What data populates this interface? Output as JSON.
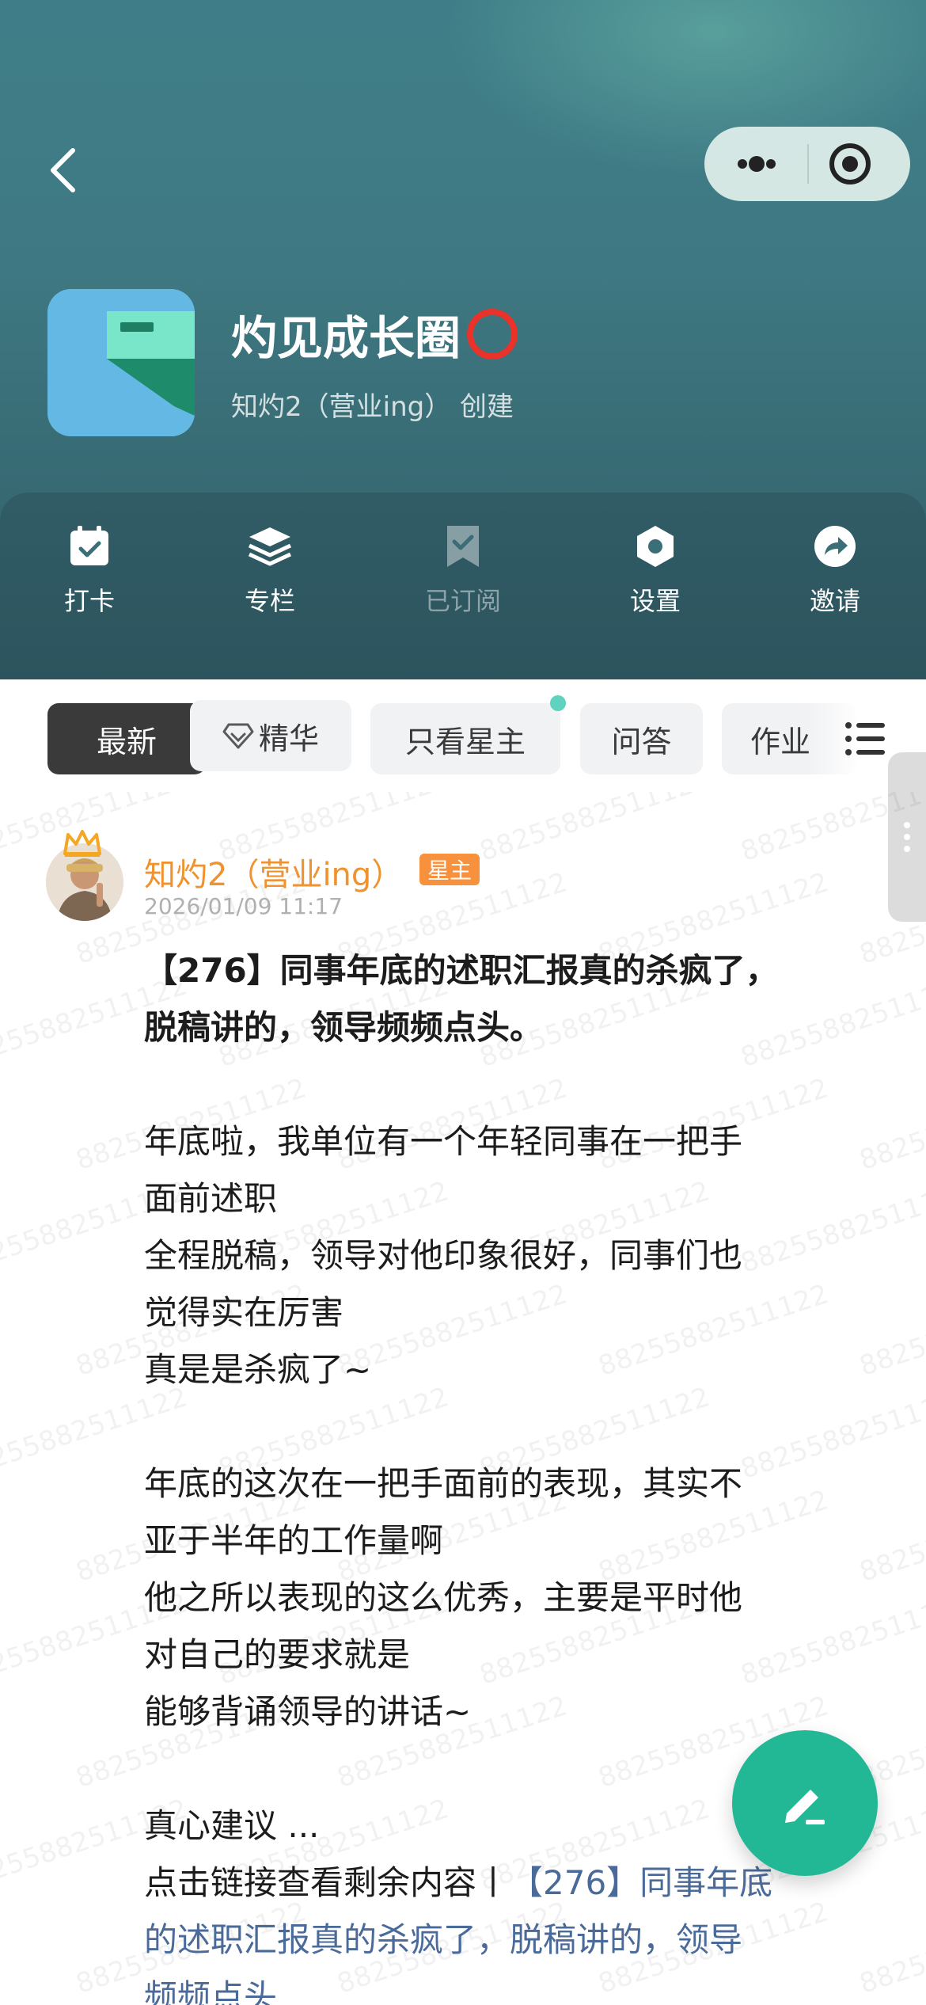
{
  "header": {
    "circle_name": "灼见成长圈",
    "creator_line": "知灼2（营业ing） 创建",
    "actions": [
      {
        "label": "打卡",
        "icon": "checkin-calendar-icon"
      },
      {
        "label": "专栏",
        "icon": "layers-icon"
      },
      {
        "label": "已订阅",
        "icon": "bookmark-check-icon"
      },
      {
        "label": "设置",
        "icon": "hexagon-settings-icon"
      },
      {
        "label": "邀请",
        "icon": "share-arrow-icon"
      }
    ]
  },
  "tabs": [
    {
      "label": "最新",
      "active": true
    },
    {
      "label": "精华",
      "icon": "diamond-icon"
    },
    {
      "label": "只看星主"
    },
    {
      "label": "问答"
    },
    {
      "label": "作业"
    }
  ],
  "post": {
    "author": "知灼2（营业ing）",
    "badge": "星主",
    "time": "2026/01/09 11:17",
    "title_lines": [
      "【276】同事年底的述职汇报真的杀疯了，",
      "脱稿讲的，领导频频点头。"
    ],
    "para1": [
      "年底啦，我单位有一个年轻同事在一把手",
      "面前述职",
      "全程脱稿，领导对他印象很好，同事们也",
      "觉得实在厉害",
      "真是是杀疯了~"
    ],
    "para2": [
      "年底的这次在一把手面前的表现，其实不",
      "亚于半年的工作量啊",
      "他之所以表现的这么优秀，主要是平时他",
      "对自己的要求就是",
      "能够背诵领导的讲话~"
    ],
    "more": "真心建议 ...",
    "link_lead": "点击链接查看剩余内容丨",
    "link_text_1": "【276】同事年底",
    "link_text_2": "的述职汇报真的杀疯了，脱稿讲的，领导",
    "link_text_3": "频频点头"
  },
  "watermark": "88255882511122",
  "colors": {
    "accent": "#22b795",
    "author": "#f0922e",
    "link": "#4a6a9a",
    "header": "#3f7e88"
  }
}
